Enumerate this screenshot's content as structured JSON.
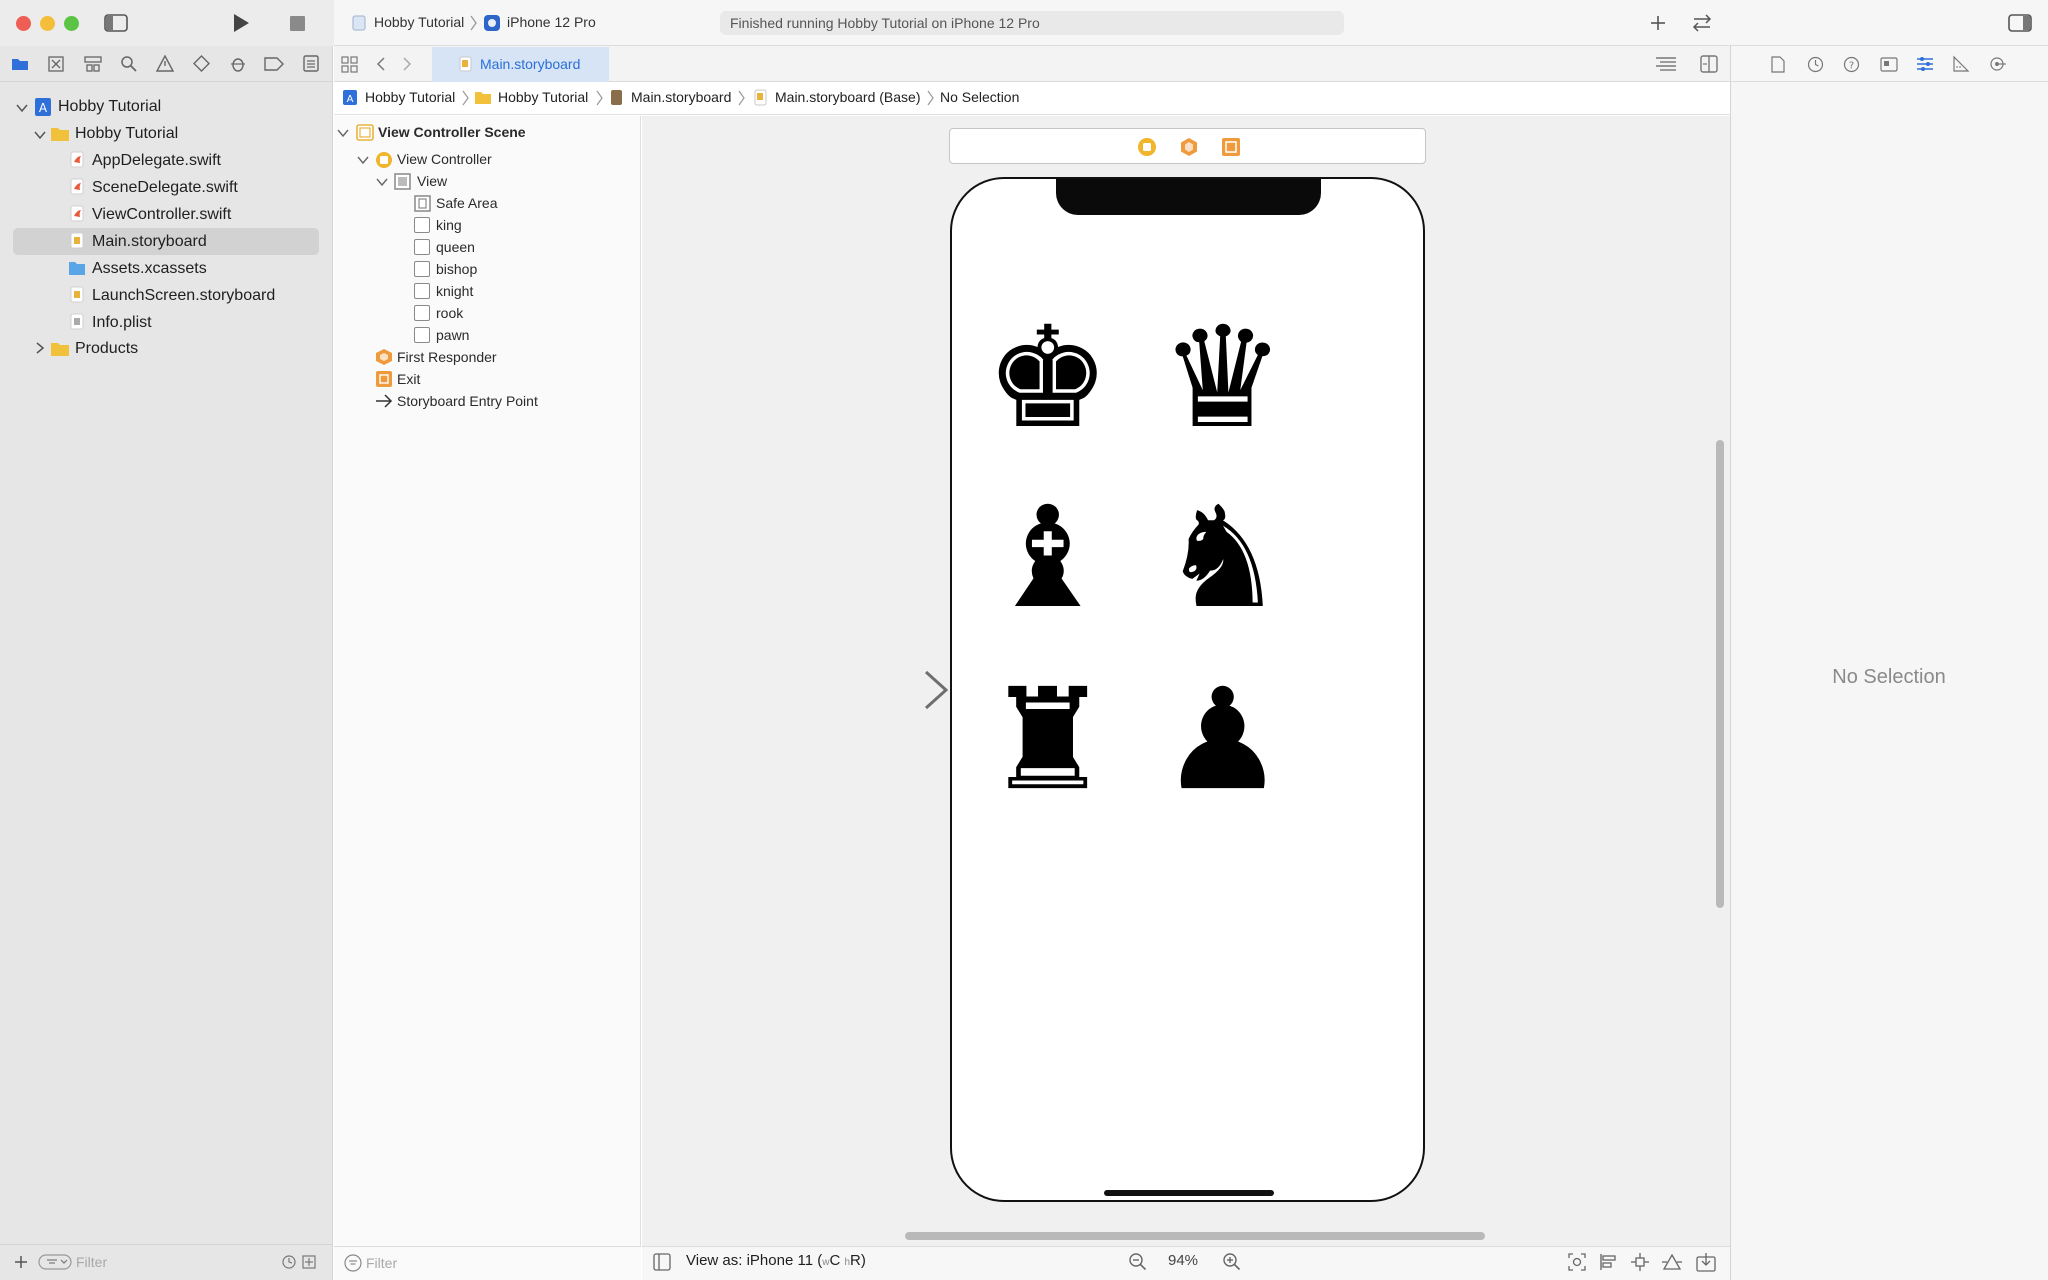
{
  "toolbar": {
    "scheme": "Hobby Tutorial",
    "device": "iPhone 12 Pro",
    "status": "Finished running Hobby Tutorial on iPhone 12 Pro"
  },
  "navigator": {
    "items": [
      {
        "label": "Hobby Tutorial"
      },
      {
        "label": "Hobby Tutorial"
      },
      {
        "label": "AppDelegate.swift"
      },
      {
        "label": "SceneDelegate.swift"
      },
      {
        "label": "ViewController.swift"
      },
      {
        "label": "Main.storyboard"
      },
      {
        "label": "Assets.xcassets"
      },
      {
        "label": "LaunchScreen.storyboard"
      },
      {
        "label": "Info.plist"
      },
      {
        "label": "Products"
      }
    ],
    "filter_placeholder": "Filter"
  },
  "editor": {
    "tab_label": "Main.storyboard",
    "breadcrumbs": [
      "Hobby Tutorial",
      "Hobby Tutorial",
      "Main.storyboard",
      "Main.storyboard (Base)",
      "No Selection"
    ]
  },
  "outline": {
    "scene": "View Controller Scene",
    "view_controller": "View Controller",
    "view": "View",
    "children": [
      "Safe Area",
      "king",
      "queen",
      "bishop",
      "knight",
      "rook",
      "pawn"
    ],
    "first_responder": "First Responder",
    "exit": "Exit",
    "entry_point": "Storyboard Entry Point",
    "filter_placeholder": "Filter"
  },
  "canvas": {
    "view_as": "View as: iPhone 11 (",
    "size_w": "w",
    "size_c": "C",
    "size_h": "h",
    "size_r": "R)",
    "zoom": "94%",
    "pieces": [
      {
        "name": "king",
        "glyph": "♚"
      },
      {
        "name": "queen",
        "glyph": "♛"
      },
      {
        "name": "bishop",
        "glyph": "♝"
      },
      {
        "name": "knight",
        "glyph": "♞"
      },
      {
        "name": "rook",
        "glyph": "♜"
      },
      {
        "name": "pawn",
        "glyph": "♟"
      }
    ]
  },
  "inspector": {
    "empty_label": "No Selection"
  },
  "colors": {
    "accent": "#2f6fd9",
    "swift": "#e8593a",
    "folder": "#f2c13c",
    "storyboard": "#e8b33c"
  }
}
